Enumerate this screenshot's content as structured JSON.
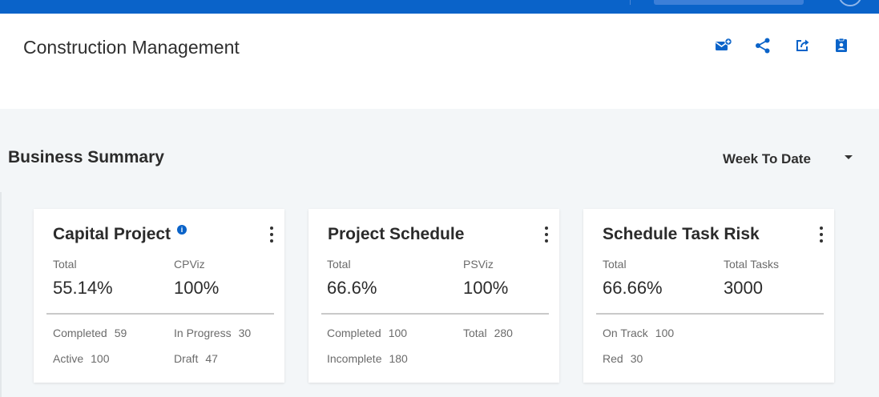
{
  "header": {
    "title": "Construction Management",
    "icons": [
      "mail-add-icon",
      "share-icon",
      "export-icon",
      "contact-card-icon"
    ]
  },
  "section": {
    "title": "Business Summary",
    "range": "Week To Date"
  },
  "colors": {
    "brand": "#0a63c9",
    "background": "#f3f6f8",
    "card": "#ffffff"
  },
  "cards": [
    {
      "title": "Capital Project",
      "has_info": true,
      "metric1": {
        "label": "Total",
        "value": "55.14%"
      },
      "metric2": {
        "label": "CPViz",
        "value": "100%"
      },
      "stats": [
        {
          "label": "Completed",
          "value": "59"
        },
        {
          "label": "In Progress",
          "value": "30"
        },
        {
          "label": "Active",
          "value": "100"
        },
        {
          "label": "Draft",
          "value": "47"
        }
      ]
    },
    {
      "title": "Project Schedule",
      "has_info": false,
      "metric1": {
        "label": "Total",
        "value": "66.6%"
      },
      "metric2": {
        "label": "PSViz",
        "value": "100%"
      },
      "stats": [
        {
          "label": "Completed",
          "value": "100"
        },
        {
          "label": "Total",
          "value": "280"
        },
        {
          "label": "Incomplete",
          "value": "180"
        }
      ]
    },
    {
      "title": "Schedule Task Risk",
      "has_info": false,
      "metric1": {
        "label": "Total",
        "value": "66.66%"
      },
      "metric2": {
        "label": "Total Tasks",
        "value": "3000"
      },
      "stats": [
        {
          "label": "On Track",
          "value": "100"
        },
        {
          "label": "Red",
          "value": "30"
        }
      ]
    }
  ]
}
